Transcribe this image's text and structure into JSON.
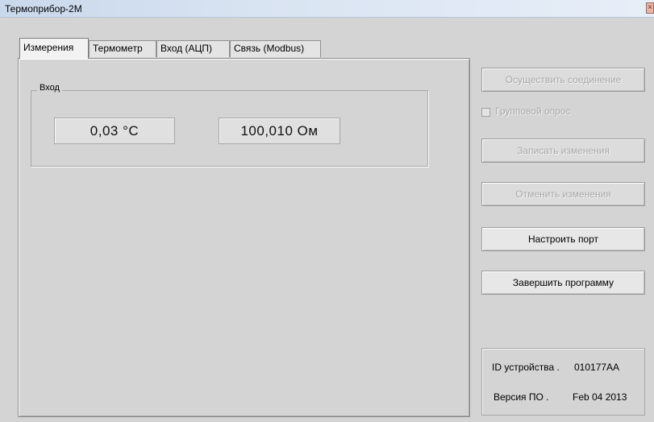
{
  "window": {
    "title": "Термоприбор-2М",
    "close_glyph": "×"
  },
  "tabs": [
    {
      "label": "Измерения",
      "active": true
    },
    {
      "label": "Термометр",
      "active": false
    },
    {
      "label": "Вход (АЦП)",
      "active": false
    },
    {
      "label": "Связь (Modbus)",
      "active": false
    }
  ],
  "measurements": {
    "group_label": "Вход",
    "temperature": "0,03 °C",
    "resistance": "100,010 Ом"
  },
  "buttons": {
    "connect": "Осуществить соединение",
    "group_poll": "Групповой опрос",
    "save_changes": "Записать изменения",
    "cancel_changes": "Отменить изменения",
    "configure_port": "Настроить порт",
    "exit_program": "Завершить программу"
  },
  "device_info": {
    "id_label": "ID устройства .",
    "id_value": "010177AA",
    "version_label": "Версия ПО .",
    "version_value": "Feb 04 2013"
  }
}
